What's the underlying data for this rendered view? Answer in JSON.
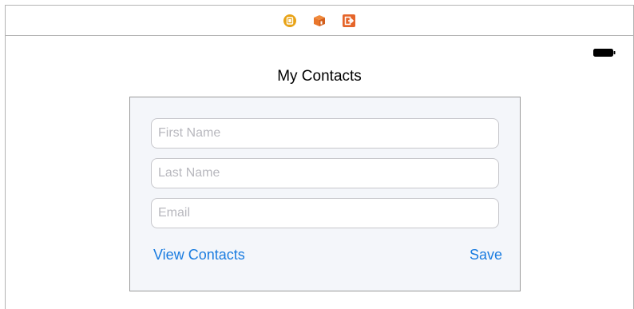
{
  "dock": {
    "icons": [
      "view-controller-icon",
      "first-responder-icon",
      "exit-icon"
    ],
    "colors": {
      "controller": "#e8a317",
      "responder": "#e9762b",
      "exit": "#e5652a"
    }
  },
  "navigation": {
    "title": "My Contacts"
  },
  "form": {
    "first_name_placeholder": "First Name",
    "last_name_placeholder": "Last Name",
    "email_placeholder": "Email",
    "view_contacts_label": "View Contacts",
    "save_label": "Save"
  },
  "colors": {
    "accent": "#1a7ce0",
    "form_background": "#f4f6fa"
  }
}
